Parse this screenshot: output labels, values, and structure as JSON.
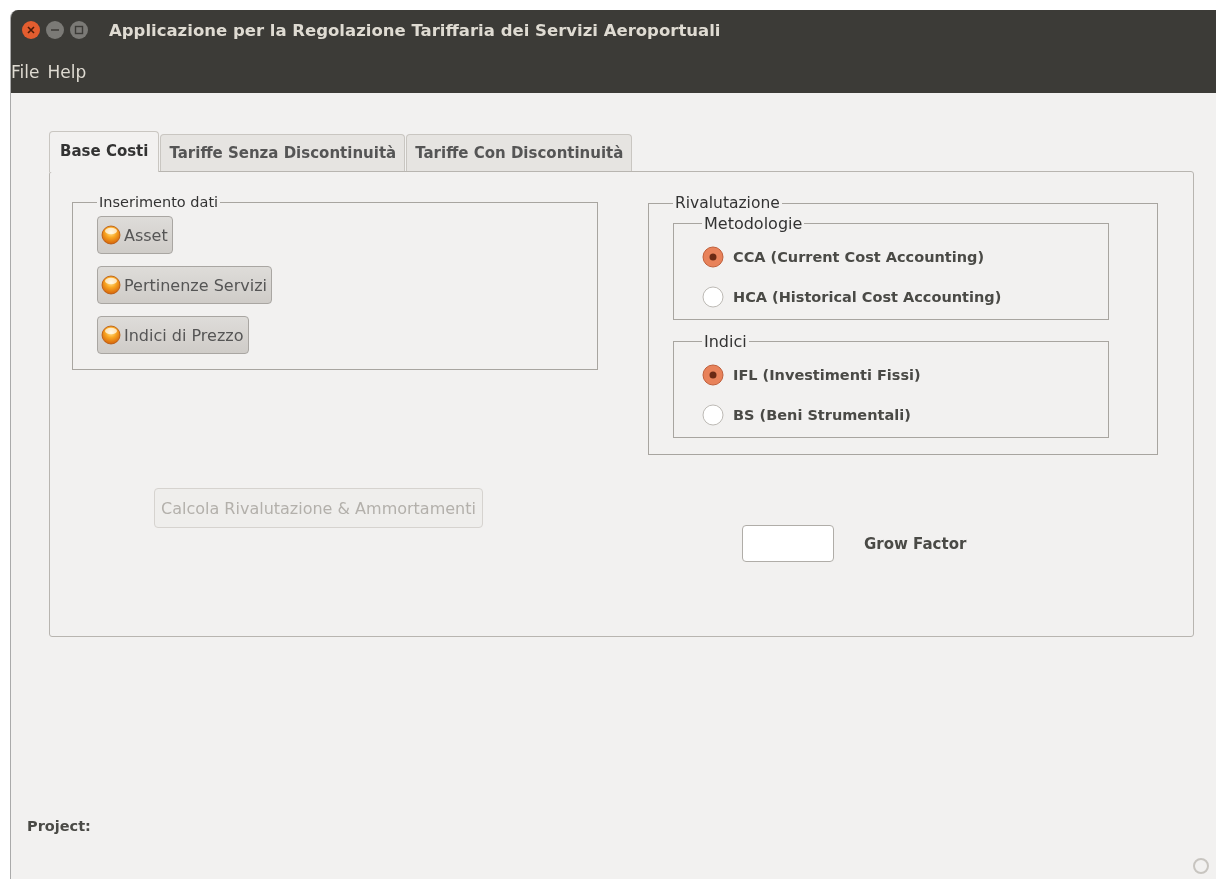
{
  "window": {
    "title": "Applicazione per la Regolazione Tariffaria dei Servizi Aeroportuali"
  },
  "menu": [
    "File",
    "Help"
  ],
  "tabs": [
    {
      "label": "Base Costi",
      "selected": true
    },
    {
      "label": "Tariffe Senza Discontinuità",
      "selected": false
    },
    {
      "label": "Tariffe Con Discontinuità",
      "selected": false
    }
  ],
  "data_entry": {
    "title": "Inserimento dati",
    "buttons": [
      {
        "label": "Asset"
      },
      {
        "label": "Pertinenze Servizi"
      },
      {
        "label": "Indici di Prezzo"
      }
    ]
  },
  "compute_button": {
    "label": "Calcola Rivalutazione & Ammortamenti",
    "disabled": true
  },
  "revaluation": {
    "title": "Rivalutazione",
    "groups": [
      {
        "title": "Metodologie",
        "options": [
          {
            "label": "CCA (Current Cost Accounting)",
            "selected": true
          },
          {
            "label": "HCA (Historical Cost Accounting)",
            "selected": false
          }
        ]
      },
      {
        "title": "Indici",
        "options": [
          {
            "label": "IFL (Investimenti Fissi)",
            "selected": true
          },
          {
            "label": "BS (Beni Strumentali)",
            "selected": false
          }
        ]
      }
    ]
  },
  "grow_factor": {
    "label": "Grow Factor"
  },
  "status": {
    "label": "Project:"
  }
}
